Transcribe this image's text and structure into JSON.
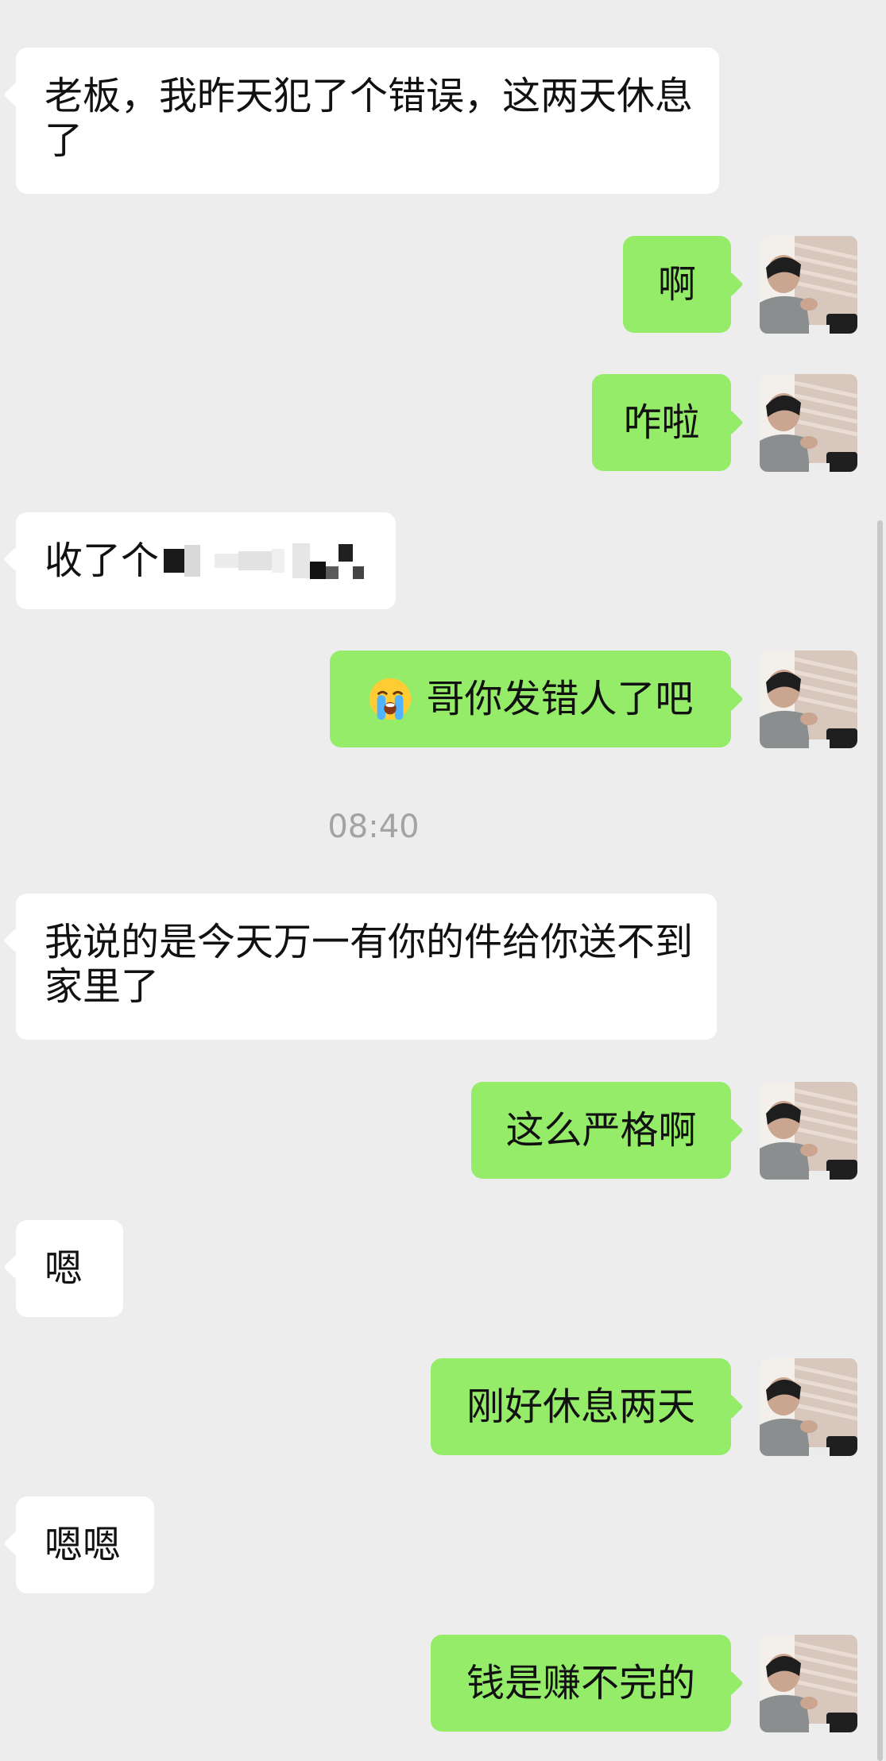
{
  "timestamp": "08:40",
  "messages": [
    {
      "id": "m1",
      "side": "in",
      "text": "老板，我昨天犯了个错误，这两天休息了"
    },
    {
      "id": "m2",
      "side": "out",
      "text": "啊"
    },
    {
      "id": "m3",
      "side": "out",
      "text": "咋啦"
    },
    {
      "id": "m4",
      "side": "in",
      "text": "收了个"
    },
    {
      "id": "m5",
      "side": "out",
      "emoji": "loudly-crying-face",
      "text": "哥你发错人了吧"
    },
    {
      "id": "m6",
      "side": "in",
      "text": "我说的是今天万一有你的件给你送不到家里了"
    },
    {
      "id": "m7",
      "side": "out",
      "text": "这么严格啊"
    },
    {
      "id": "m8",
      "side": "in",
      "text": "嗯"
    },
    {
      "id": "m9",
      "side": "out",
      "text": "刚好休息两天"
    },
    {
      "id": "m10",
      "side": "in",
      "text": "嗯嗯"
    },
    {
      "id": "m11",
      "side": "out",
      "text": "钱是赚不完的"
    }
  ],
  "colors": {
    "background": "#ededed",
    "incoming_bubble": "#ffffff",
    "outgoing_bubble": "#95ec69",
    "timestamp_text": "#a3a3a3"
  }
}
